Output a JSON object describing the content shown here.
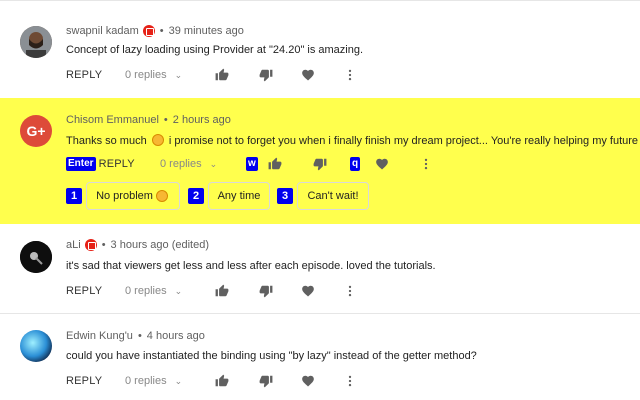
{
  "comments": [
    {
      "author": "swapnil kadam",
      "time": "39 minutes ago",
      "text": "Concept of lazy loading using Provider at \"24.20\" is amazing.",
      "reply_label": "REPLY",
      "replies": "0 replies"
    },
    {
      "author": "Chisom Emmanuel",
      "time": "2 hours ago",
      "text_before": "Thanks so much",
      "text_after": "i promise not to forget you when i finally finish my dream project... You're really helping my future",
      "reply_label": "REPLY",
      "replies": "0 replies",
      "hints": {
        "enter": "Enter",
        "like": "w",
        "dislike": "q"
      },
      "quick_replies": [
        {
          "hint": "1",
          "label": "No problem"
        },
        {
          "hint": "2",
          "label": "Any time"
        },
        {
          "hint": "3",
          "label": "Can't wait!"
        }
      ]
    },
    {
      "author": "aLi",
      "time": "3 hours ago (edited)",
      "text": "it's sad that viewers get less and less after each episode. loved the tutorials.",
      "reply_label": "REPLY",
      "replies": "0 replies"
    },
    {
      "author": "Edwin Kung'u",
      "time": "4 hours ago",
      "text": "could you have instantiated the binding using \"by lazy\" instead of the getter method?",
      "reply_label": "REPLY",
      "replies": "0 replies"
    }
  ],
  "separator": "•",
  "colors": {
    "highlight": "#ffff4d",
    "hint": "#0000ee",
    "badge": "#e62117"
  }
}
